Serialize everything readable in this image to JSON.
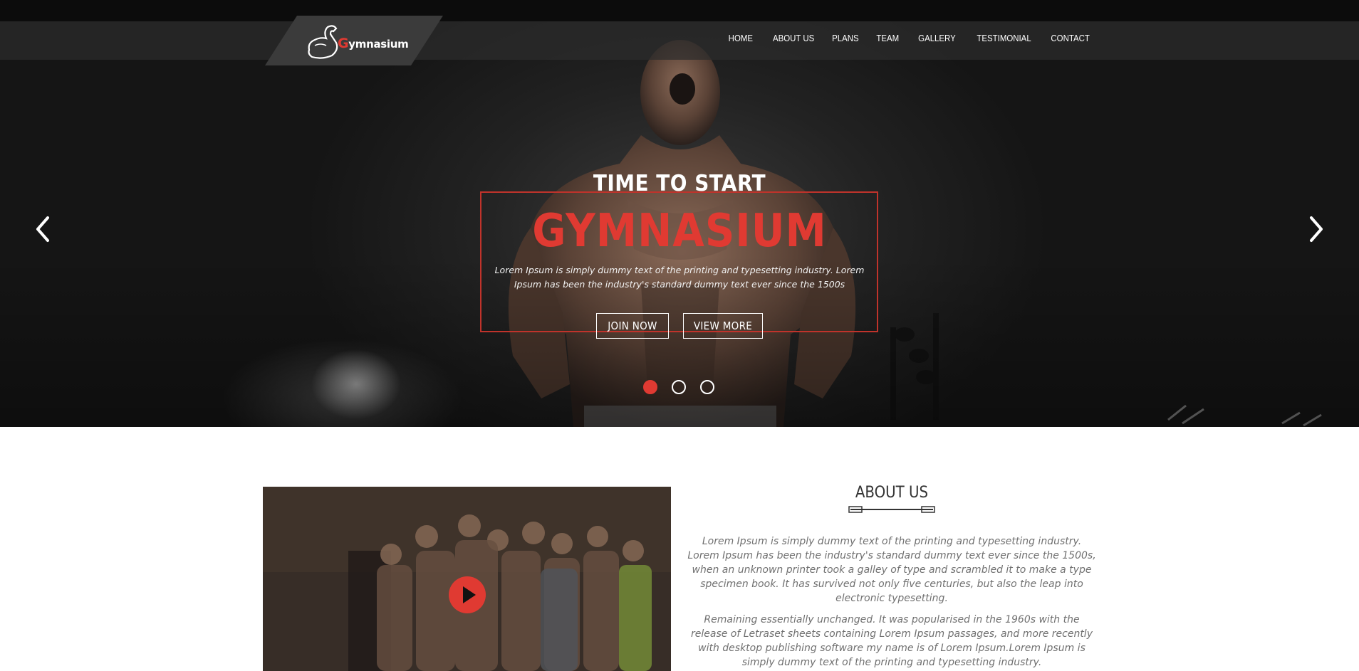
{
  "brand": {
    "logo_text_rest": "ymnasium",
    "logo_letter": "G"
  },
  "nav": {
    "items": [
      "HOME",
      "ABOUT US",
      "PLANS",
      "TEAM",
      "GALLERY",
      "TESTIMONIAL",
      "CONTACT"
    ]
  },
  "hero": {
    "subtitle": "TIME TO START",
    "title": "GYMNASIUM",
    "text": "Lorem Ipsum is simply dummy text of the printing and typesetting industry. Lorem Ipsum has been the industry's standard dummy text ever since the 1500s",
    "join_label": "JOIN NOW",
    "view_label": "VIEW MORE",
    "slides": 3,
    "active_slide": 1
  },
  "about": {
    "title": "ABOUT US",
    "p1": "Lorem Ipsum is simply dummy text of the printing and typesetting industry. Lorem Ipsum has been the industry's standard dummy text ever since the 1500s, when an unknown printer took a galley of type and scrambled it to make a type specimen book. It has survived not only five centuries, but also the leap into electronic typesetting.",
    "p2": "Remaining essentially unchanged. It was popularised in the 1960s with the release of Letraset sheets containing Lorem Ipsum passages, and more recently with desktop publishing software my name is of Lorem Ipsum.Lorem Ipsum is simply dummy text of the printing and typesetting industry."
  },
  "colors": {
    "accent": "#e03a32",
    "nav_bg": "#2d2d2d",
    "text_muted": "#707070"
  }
}
